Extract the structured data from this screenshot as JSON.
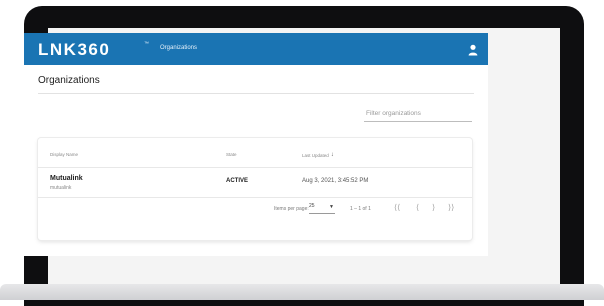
{
  "app": {
    "logo": "LNK360",
    "logo_mark": "™",
    "nav_label": "Organizations"
  },
  "page": {
    "title": "Organizations",
    "filter_placeholder": "Filter organizations"
  },
  "table": {
    "columns": [
      "Display Name",
      "State",
      "Last Updated"
    ],
    "sort_arrow": "↓",
    "rows": [
      {
        "display_name": "Mutualink",
        "sub_name": "mutualink",
        "state": "ACTIVE",
        "last_updated": "Aug 3, 2021, 3:45:52 PM"
      }
    ]
  },
  "paginator": {
    "items_per_page_label": "Items per page:",
    "items_per_page_value": "25",
    "range_label": "1 – 1 of 1",
    "first": "⟨⟨",
    "prev": "⟨",
    "next": "⟩",
    "last": "⟩⟩"
  },
  "colors": {
    "app_bar": "#1a74b3",
    "bezel": "#0e0e10"
  },
  "icons": {
    "account": "person-icon",
    "sort": "arrow-down-icon",
    "select": "caret-down-icon"
  }
}
